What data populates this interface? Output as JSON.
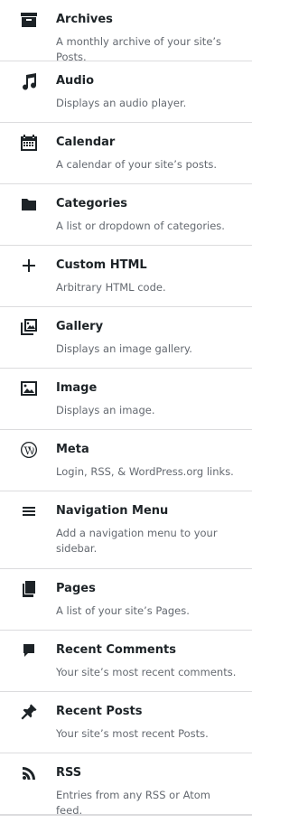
{
  "widgets": [
    {
      "title": "Archives",
      "description": "A monthly archive of your site’s Posts.",
      "icon": "archive-icon"
    },
    {
      "title": "Audio",
      "description": "Displays an audio player.",
      "icon": "music-note-icon"
    },
    {
      "title": "Calendar",
      "description": "A calendar of your site’s posts.",
      "icon": "calendar-icon"
    },
    {
      "title": "Categories",
      "description": "A list or dropdown of categories.",
      "icon": "folder-icon"
    },
    {
      "title": "Custom HTML",
      "description": "Arbitrary HTML code.",
      "icon": "plus-icon"
    },
    {
      "title": "Gallery",
      "description": "Displays an image gallery.",
      "icon": "gallery-icon"
    },
    {
      "title": "Image",
      "description": "Displays an image.",
      "icon": "image-icon"
    },
    {
      "title": "Meta",
      "description": "Login, RSS, & WordPress.org links.",
      "icon": "wordpress-icon"
    },
    {
      "title": "Navigation Menu",
      "description": "Add a navigation menu to your sidebar.",
      "icon": "menu-icon"
    },
    {
      "title": "Pages",
      "description": "A list of your site’s Pages.",
      "icon": "pages-icon"
    },
    {
      "title": "Recent Comments",
      "description": "Your site’s most recent comments.",
      "icon": "comment-icon"
    },
    {
      "title": "Recent Posts",
      "description": "Your site’s most recent Posts.",
      "icon": "pushpin-icon"
    },
    {
      "title": "RSS",
      "description": "Entries from any RSS or Atom feed.",
      "icon": "rss-icon"
    }
  ]
}
